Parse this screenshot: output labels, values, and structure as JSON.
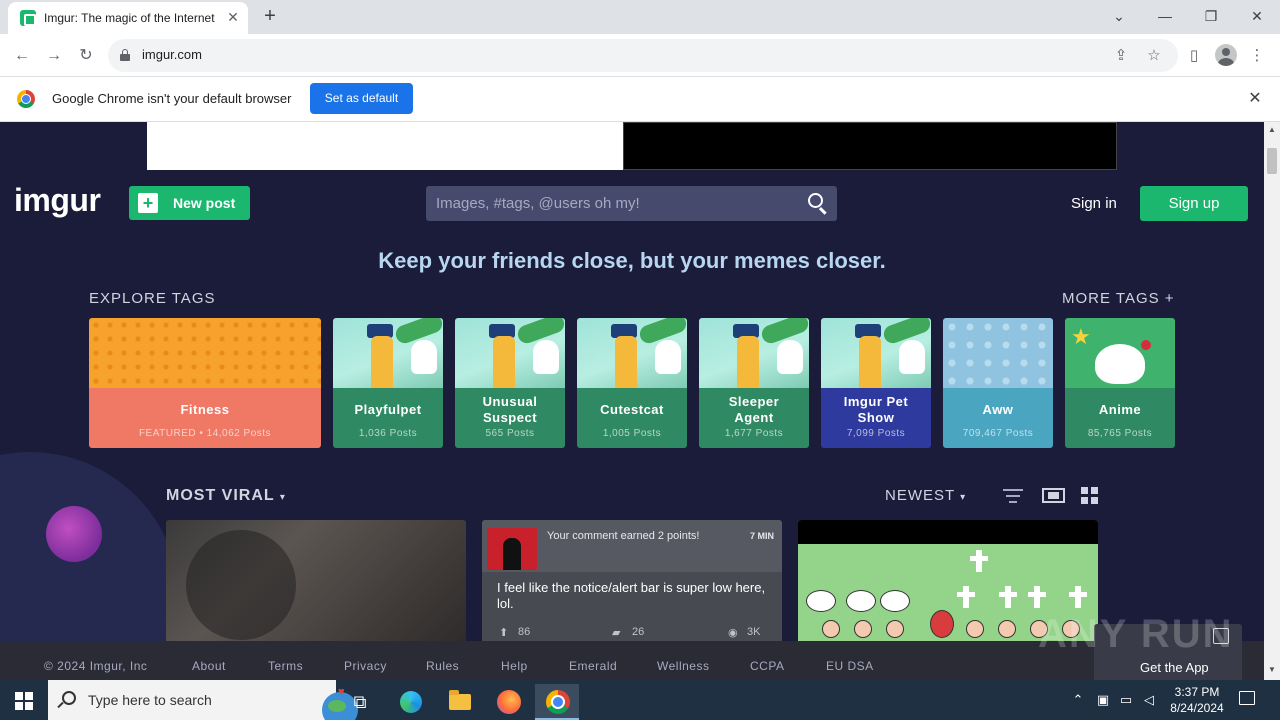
{
  "browser": {
    "tab_title": "Imgur: The magic of the Internet",
    "tab_close": "✕",
    "new_tab": "+",
    "url": "imgur.com",
    "controls": {
      "chevron": "⌄",
      "minimize": "—",
      "restore": "❐",
      "close": "✕"
    }
  },
  "infobar": {
    "message": "Google Chrome isn't your default browser",
    "button": "Set as default",
    "close": "✕"
  },
  "header": {
    "logo": "imgur",
    "new_post": "New post",
    "search_placeholder": "Images, #tags, @users oh my!",
    "sign_in": "Sign in",
    "sign_up": "Sign up"
  },
  "tagline": "Keep your friends close, but your memes closer.",
  "explore": {
    "title": "EXPLORE TAGS",
    "more": "MORE TAGS +",
    "tags": [
      {
        "name": "Fitness",
        "count": "FEATURED • 14,062 Posts",
        "color": "#f07966"
      },
      {
        "name": "Playfulpet",
        "count": "1,036 Posts",
        "color": "#2f8a63"
      },
      {
        "name": "Unusual Suspect",
        "count": "565 Posts",
        "color": "#2f8a63"
      },
      {
        "name": "Cutestcat",
        "count": "1,005 Posts",
        "color": "#2f8a63"
      },
      {
        "name": "Sleeper Agent",
        "count": "1,677 Posts",
        "color": "#2f8a63"
      },
      {
        "name": "Imgur Pet Show",
        "count": "7,099 Posts",
        "color": "#2f3a9e"
      },
      {
        "name": "Aww",
        "count": "709,467 Posts",
        "color": "#4aa6c0"
      },
      {
        "name": "Anime",
        "count": "85,765 Posts",
        "color": "#2f8a63"
      }
    ]
  },
  "feed": {
    "title": "MOST VIRAL",
    "sort": "NEWEST",
    "caret": "▾",
    "posts": [
      {},
      {
        "notice": "Your comment earned 2 points!",
        "time": "7 MIN",
        "text": "I feel like the notice/alert bar is super low here, lol.",
        "upvotes": "86",
        "comments": "26",
        "views": "3K"
      },
      {}
    ]
  },
  "footer": {
    "links": [
      "© 2024 Imgur, Inc",
      "About",
      "Terms",
      "Privacy",
      "Rules",
      "Help",
      "Emerald",
      "Wellness",
      "CCPA",
      "EU DSA"
    ],
    "get_app": "Get the App"
  },
  "watermark": "ANY RUN",
  "taskbar": {
    "search_placeholder": "Type here to search",
    "time": "3:37 PM",
    "date": "8/24/2024"
  }
}
